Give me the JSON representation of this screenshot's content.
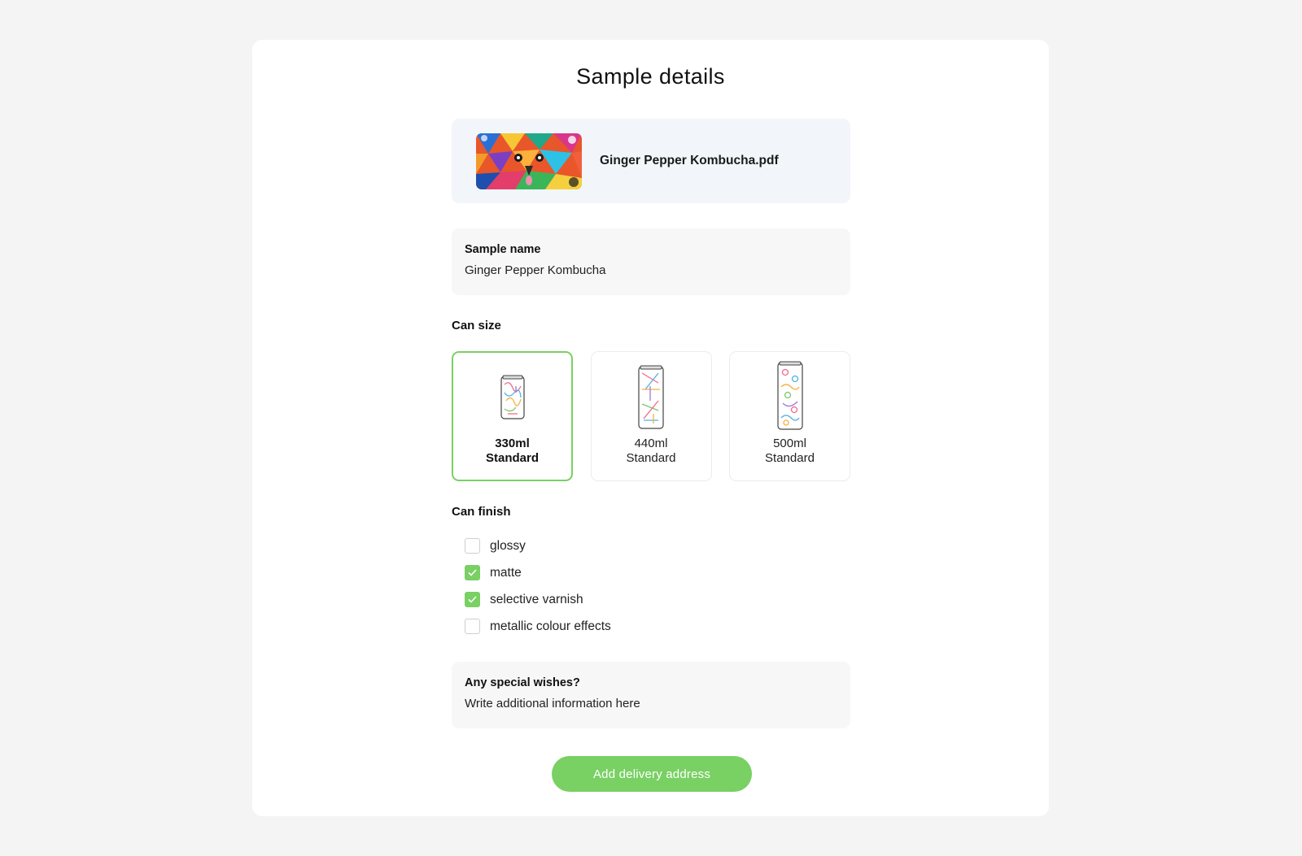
{
  "page": {
    "title": "Sample details"
  },
  "file": {
    "name": "Ginger Pepper Kombucha.pdf",
    "thumbnail_icon": "colorful-lion-artwork-thumbnail"
  },
  "sample_name": {
    "label": "Sample name",
    "value": "Ginger Pepper Kombucha"
  },
  "can_size": {
    "label": "Can size",
    "options": [
      {
        "volume": "330ml",
        "type": "Standard",
        "selected": true,
        "icon": "can-330-icon"
      },
      {
        "volume": "440ml",
        "type": "Standard",
        "selected": false,
        "icon": "can-440-icon"
      },
      {
        "volume": "500ml",
        "type": "Standard",
        "selected": false,
        "icon": "can-500-icon"
      }
    ]
  },
  "can_finish": {
    "label": "Can finish",
    "options": [
      {
        "label": "glossy",
        "checked": false
      },
      {
        "label": "matte",
        "checked": true
      },
      {
        "label": "selective varnish",
        "checked": true
      },
      {
        "label": "metallic colour effects",
        "checked": false
      }
    ]
  },
  "special_wishes": {
    "label": "Any special wishes?",
    "placeholder": "Write additional information here"
  },
  "actions": {
    "submit_label": "Add delivery address"
  },
  "colors": {
    "accent": "#79d063",
    "card": "#ffffff",
    "background": "#f4f4f4",
    "file_box": "#f2f6fa",
    "field_box": "#f7f7f7"
  }
}
